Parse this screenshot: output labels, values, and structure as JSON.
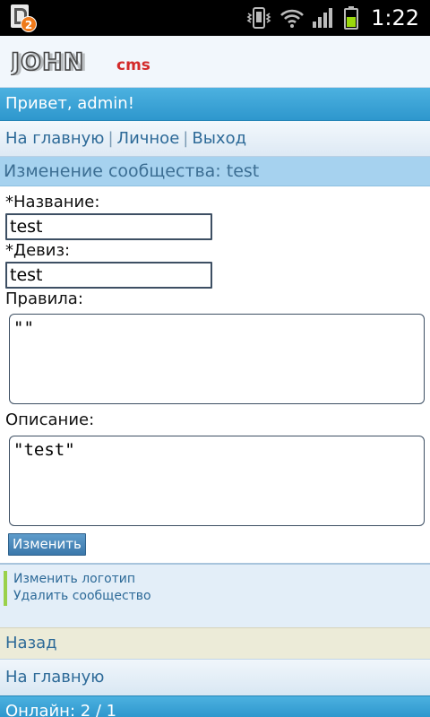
{
  "status_bar": {
    "notification_count": "2",
    "time": "1:22"
  },
  "header": {
    "logo_main": "JOHN",
    "logo_sub": "cms"
  },
  "greeting": {
    "prefix": "Привет, ",
    "user": "admin",
    "suffix": "!"
  },
  "nav": {
    "home": "На главную",
    "personal": "Личное",
    "logout": "Выход",
    "separator": "|"
  },
  "section": {
    "title": "Изменение сообщества: test"
  },
  "form": {
    "name_label": "*Название:",
    "name_value": "test",
    "motto_label": "*Девиз:",
    "motto_value": "test",
    "rules_label": "Правила:",
    "rules_value": "\"\"",
    "description_label": "Описание:",
    "description_value": "\"test\"",
    "submit_label": "Изменить"
  },
  "menu": {
    "items": [
      {
        "label": "Изменить логотип"
      },
      {
        "label": "Удалить сообщество"
      }
    ]
  },
  "back": {
    "label": "Назад"
  },
  "home_link": {
    "label": "На главную"
  },
  "footer": {
    "online": "Онлайн: 2 / 1"
  },
  "colors": {
    "accent": "#2e97cd",
    "link": "#2d6a98",
    "section_bg": "#a6d2ef",
    "badge": "#f07a1a"
  }
}
